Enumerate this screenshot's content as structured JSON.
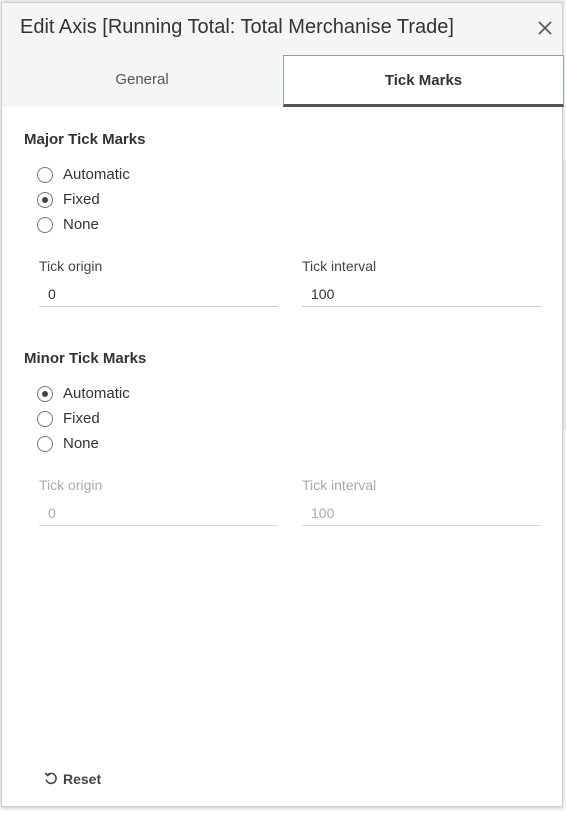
{
  "dialog": {
    "title": "Edit Axis [Running Total: Total Merchanise Trade]",
    "close_icon": "close-icon"
  },
  "tabs": [
    {
      "label": "General",
      "active": false
    },
    {
      "label": "Tick Marks",
      "active": true
    }
  ],
  "major": {
    "title": "Major Tick Marks",
    "options": [
      {
        "label": "Automatic",
        "checked": false
      },
      {
        "label": "Fixed",
        "checked": true
      },
      {
        "label": "None",
        "checked": false
      }
    ],
    "origin_label": "Tick origin",
    "origin_value": "0",
    "interval_label": "Tick interval",
    "interval_value": "100"
  },
  "minor": {
    "title": "Minor Tick Marks",
    "options": [
      {
        "label": "Automatic",
        "checked": true
      },
      {
        "label": "Fixed",
        "checked": false
      },
      {
        "label": "None",
        "checked": false
      }
    ],
    "origin_label": "Tick origin",
    "origin_value": "0",
    "interval_label": "Tick interval",
    "interval_value": "100",
    "disabled": true
  },
  "reset": {
    "label": "Reset",
    "icon": "undo-icon"
  },
  "colors": {
    "active_tab_border": "#7fa3d6",
    "active_tab_underline": "#555555",
    "disabled_text": "#aaaaaa"
  }
}
